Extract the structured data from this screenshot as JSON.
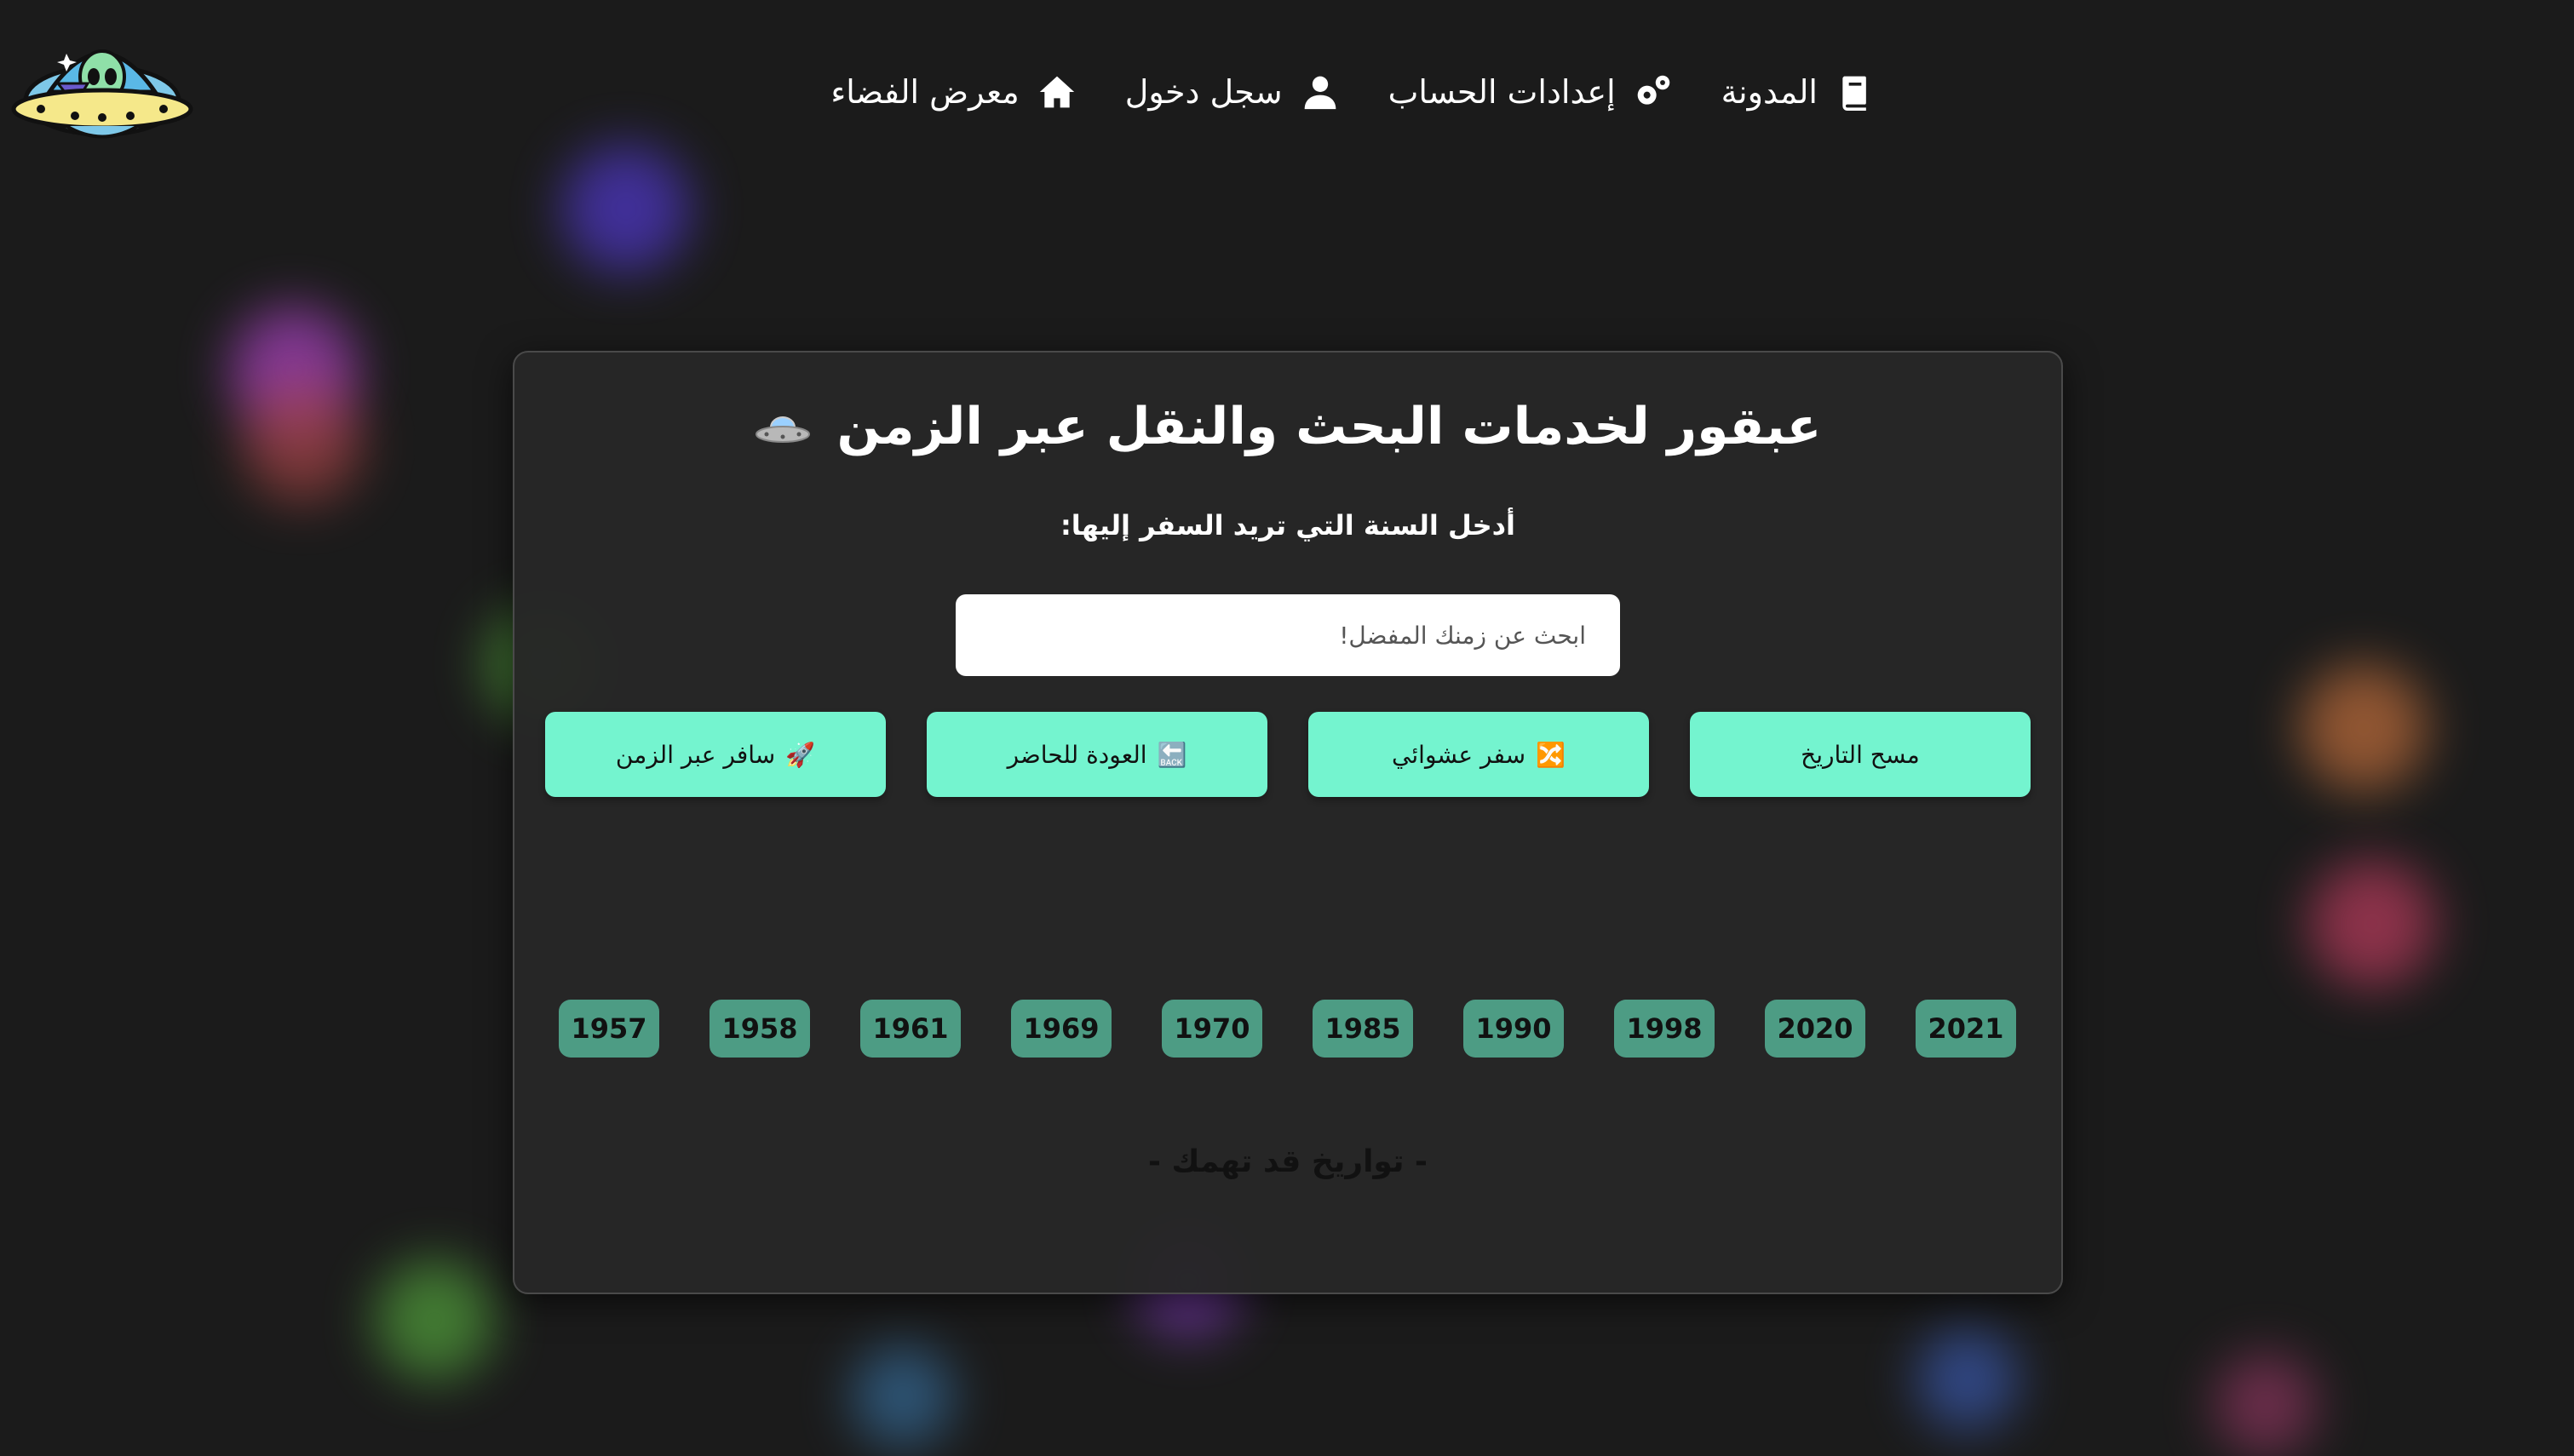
{
  "nav": {
    "items": [
      {
        "label": "المدونة",
        "icon": "book-icon"
      },
      {
        "label": "إعدادات الحساب",
        "icon": "gears-icon"
      },
      {
        "label": "سجل دخول",
        "icon": "user-icon"
      },
      {
        "label": "معرض الفضاء",
        "icon": "home-icon"
      }
    ]
  },
  "card": {
    "title": "عبقور لخدمات البحث والنقل عبر الزمن",
    "prompt": ":أدخل السنة التي تريد السفر إليها",
    "search": {
      "placeholder": "ابحث عن زمنك المفضل!",
      "value": ""
    },
    "buttons": [
      {
        "label": "سافر عبر الزمن",
        "emoji": "🚀"
      },
      {
        "label": "العودة للحاضر",
        "emoji": "🔙"
      },
      {
        "label": "سفر عشوائي",
        "emoji": "🔀"
      },
      {
        "label": "مسح التاريخ",
        "emoji": ""
      }
    ],
    "years": [
      "1957",
      "1958",
      "1961",
      "1969",
      "1970",
      "1985",
      "1990",
      "1998",
      "2020",
      "2021"
    ],
    "suggestions_label": "- تواريخ قد تهمك -"
  },
  "colors": {
    "background": "#1b1b1b",
    "card": "#262626",
    "button": "#74f4cf",
    "year_chip": "#4d9c84"
  }
}
